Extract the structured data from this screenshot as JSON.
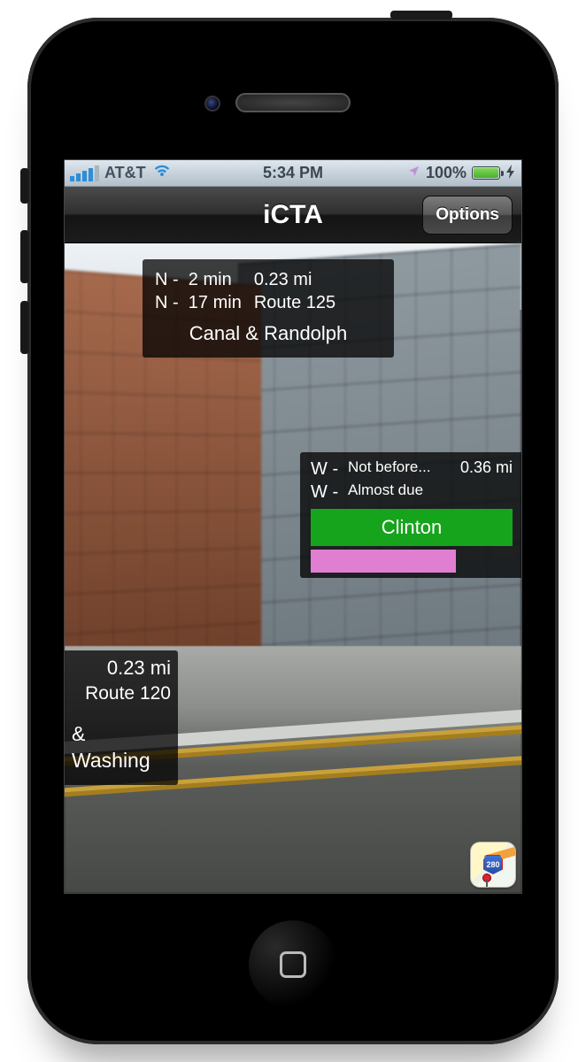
{
  "status": {
    "carrier": "AT&T",
    "time": "5:34 PM",
    "battery_pct": "100%"
  },
  "nav": {
    "title": "iCTA",
    "options_label": "Options"
  },
  "map_shield": "280",
  "cards": {
    "a": {
      "arrivals": [
        {
          "dir": "N",
          "wait": "2 min"
        },
        {
          "dir": "N",
          "wait": "17 min"
        }
      ],
      "distance": "0.23 mi",
      "route": "Route 125",
      "stop": "Canal & Randolph"
    },
    "b": {
      "lines": [
        {
          "dir": "W",
          "status": "Not before..."
        },
        {
          "dir": "W",
          "status": "Almost due"
        }
      ],
      "distance": "0.36 mi",
      "station": "Clinton"
    },
    "c": {
      "distance": "0.23 mi",
      "route": "Route 120",
      "stop_l1": "&",
      "stop_l2": "Washing"
    }
  }
}
